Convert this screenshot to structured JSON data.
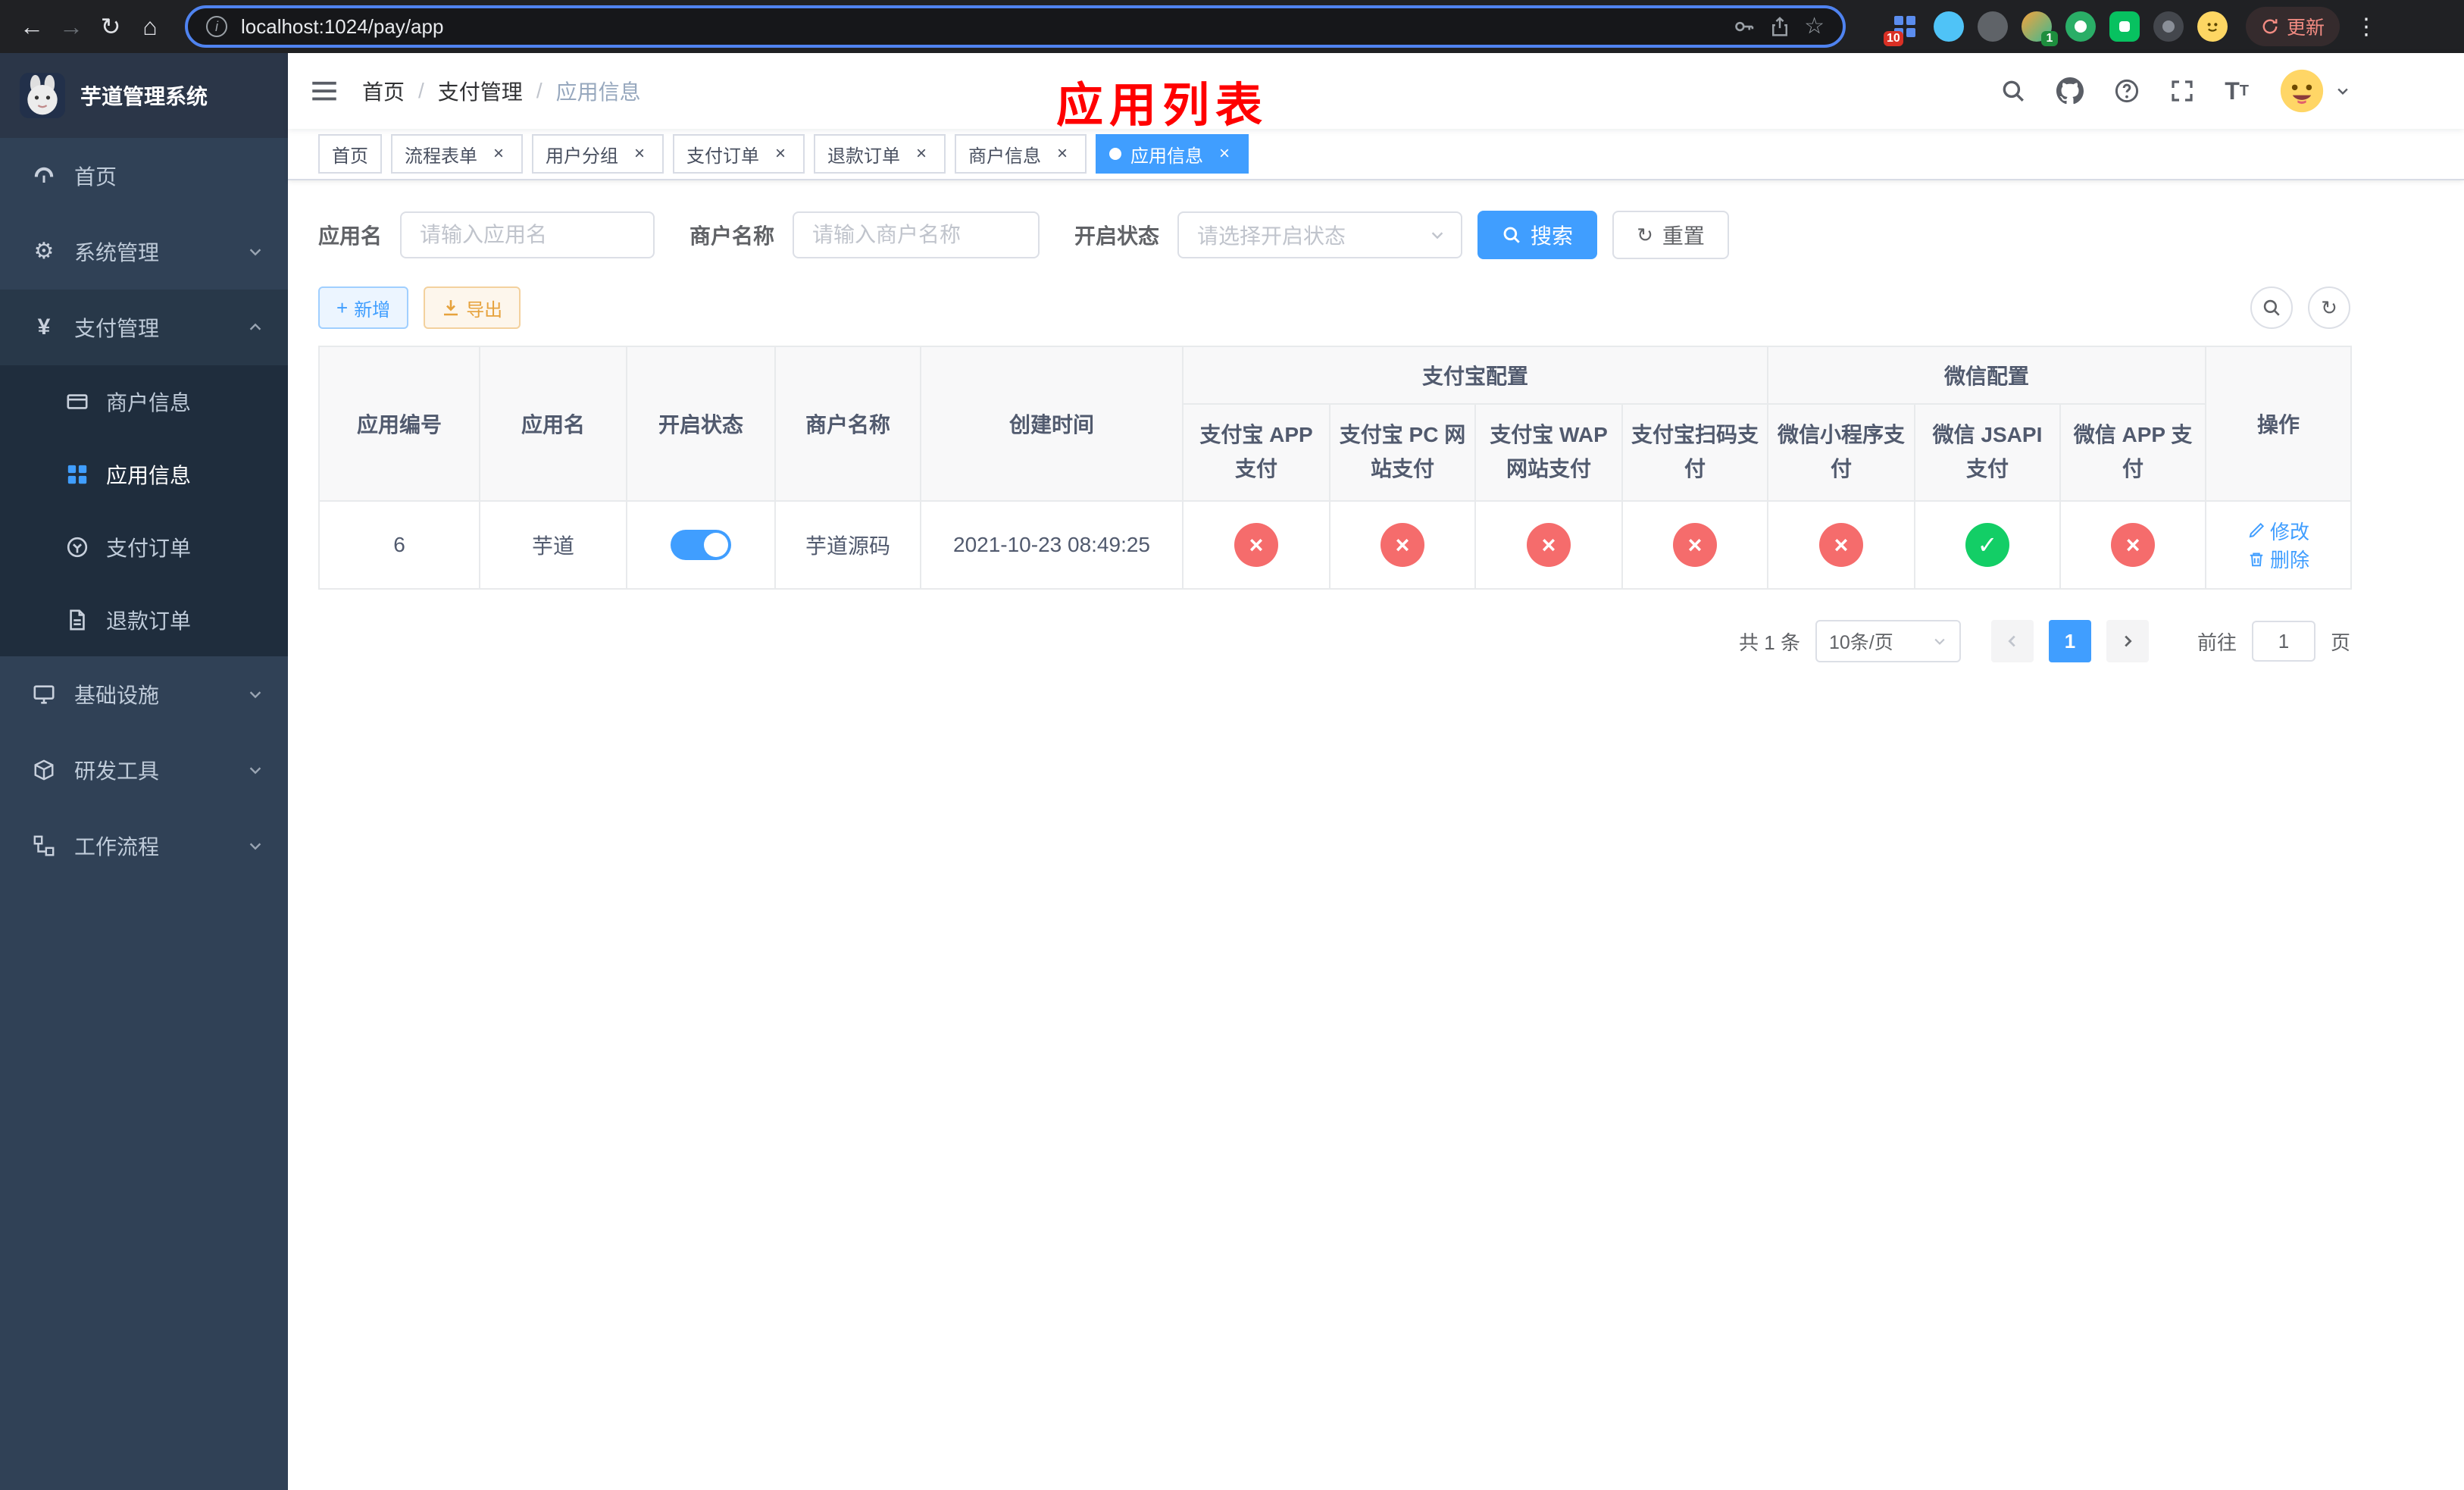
{
  "colors": {
    "accent": "#409eff",
    "success": "#13ce66",
    "danger": "#f56c6c",
    "warning": "#e6a23c",
    "sidebar_bg": "#304156",
    "submenu_bg": "#1f2d3d",
    "annotation_red": "#ff0000"
  },
  "browser": {
    "url": "localhost:1024/pay/app",
    "update_button": "更新",
    "extension_badge_grid": "10",
    "extension_badge_avatar": "1"
  },
  "sidebar": {
    "app_title": "芋道管理系统",
    "items": [
      {
        "label": "首页"
      },
      {
        "label": "系统管理"
      },
      {
        "label": "支付管理"
      },
      {
        "label": "商户信息"
      },
      {
        "label": "应用信息"
      },
      {
        "label": "支付订单"
      },
      {
        "label": "退款订单"
      },
      {
        "label": "基础设施"
      },
      {
        "label": "研发工具"
      },
      {
        "label": "工作流程"
      }
    ]
  },
  "navbar": {
    "breadcrumb": [
      "首页",
      "支付管理",
      "应用信息"
    ],
    "annotation": "应用列表"
  },
  "tabs": [
    {
      "label": "首页"
    },
    {
      "label": "流程表单"
    },
    {
      "label": "用户分组"
    },
    {
      "label": "支付订单"
    },
    {
      "label": "退款订单"
    },
    {
      "label": "商户信息"
    },
    {
      "label": "应用信息"
    }
  ],
  "filters": {
    "app_name_label": "应用名",
    "app_name_placeholder": "请输入应用名",
    "merchant_label": "商户名称",
    "merchant_placeholder": "请输入商户名称",
    "status_label": "开启状态",
    "status_placeholder": "请选择开启状态",
    "search_button": "搜索",
    "reset_button": "重置"
  },
  "toolbar": {
    "add_button": "新增",
    "export_button": "导出"
  },
  "table": {
    "group_alipay": "支付宝配置",
    "group_wechat": "微信配置",
    "columns": [
      "应用编号",
      "应用名",
      "开启状态",
      "商户名称",
      "创建时间",
      "支付宝 APP 支付",
      "支付宝 PC 网站支付",
      "支付宝 WAP 网站支付",
      "支付宝扫码支付",
      "微信小程序支付",
      "微信 JSAPI 支付",
      "微信 APP 支付",
      "操作"
    ],
    "rows": [
      {
        "id": "6",
        "name": "芋道",
        "enabled": true,
        "merchant": "芋道源码",
        "created_at": "2021-10-23 08:49:25",
        "channels": [
          "no",
          "no",
          "no",
          "no",
          "no",
          "yes",
          "no"
        ],
        "edit_label": "修改",
        "delete_label": "删除"
      }
    ]
  },
  "pagination": {
    "total": "共 1 条",
    "page_size": "10条/页",
    "page": "1",
    "goto_label": "前往",
    "goto_value": "1",
    "goto_unit": "页"
  }
}
